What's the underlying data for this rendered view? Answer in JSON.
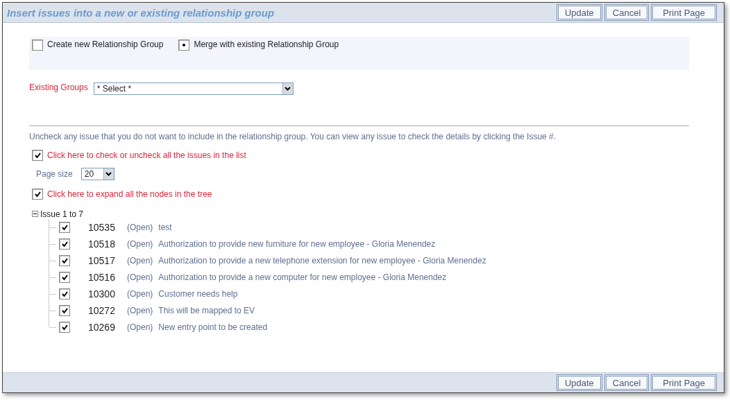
{
  "window": {
    "title": "Insert issues into a new or existing relationship group"
  },
  "header_buttons": [
    "Update",
    "Cancel",
    "Print Page"
  ],
  "group_mode": [
    {
      "label": "Create new Relationship Group",
      "selected": false
    },
    {
      "label": "Merge with existing Relationship Group",
      "selected": true
    }
  ],
  "existing_groups": {
    "label": "Existing Groups",
    "value": "* Select *"
  },
  "instructions": "Uncheck any issue that you do not want to include in the relationship group. You can view any issue to check the details by clicking the Issue #.",
  "check_all": {
    "label": "Click here to check or uncheck all the issues in the list",
    "checked": true
  },
  "page_size": {
    "label": "Page size",
    "value": "20"
  },
  "expand_all": {
    "label": "Click here to expand all the nodes in the tree",
    "checked": true
  },
  "tree": {
    "label": "Issue 1 to 7",
    "expanded": true,
    "children": [
      {
        "number": "10535",
        "status": "(Open)",
        "title": "test",
        "checked": true
      },
      {
        "number": "10518",
        "status": "(Open)",
        "title": "Authorization to provide new furniture for new employee - Gloria Menendez",
        "checked": true
      },
      {
        "number": "10517",
        "status": "(Open)",
        "title": "Authorization to provide a new telephone extension for new employee - Gloria Menendez",
        "checked": true
      },
      {
        "number": "10516",
        "status": "(Open)",
        "title": "Authorization to provide a new computer for new employee - Gloria Menendez",
        "checked": true
      },
      {
        "number": "10300",
        "status": "(Open)",
        "title": "Customer needs help",
        "checked": true
      },
      {
        "number": "10272",
        "status": "(Open)",
        "title": "This will be mapped to EV",
        "checked": true
      },
      {
        "number": "10269",
        "status": "(Open)",
        "title": "New entry point to be created",
        "checked": true
      }
    ]
  },
  "footer_buttons": [
    "Update",
    "Cancel",
    "Print Page"
  ]
}
